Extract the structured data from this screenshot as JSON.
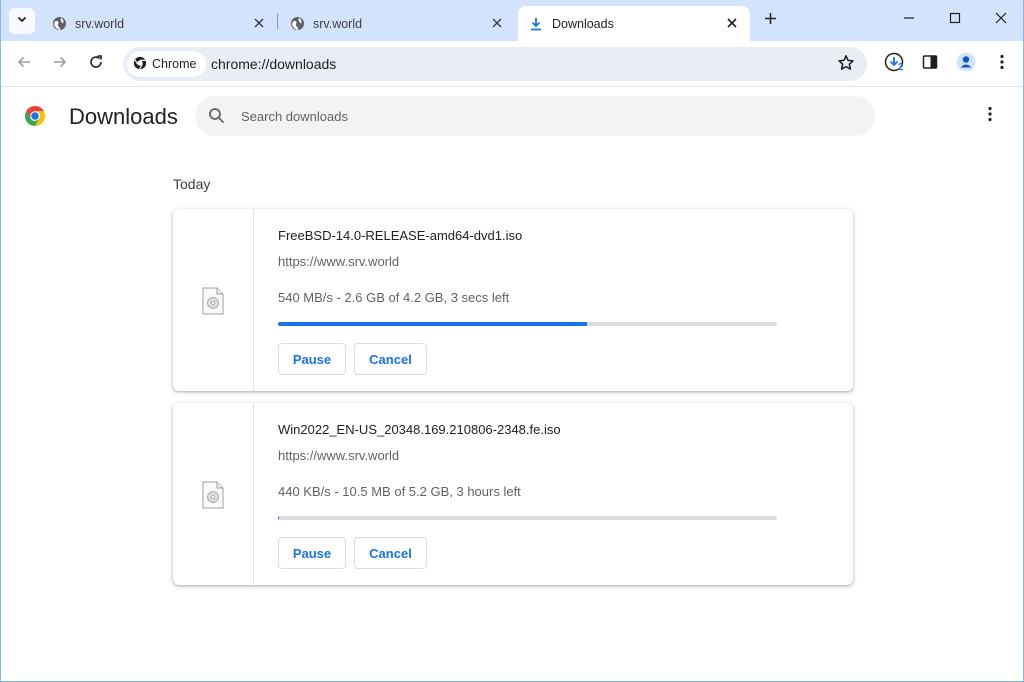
{
  "tabs": [
    {
      "title": "srv.world",
      "active": false
    },
    {
      "title": "srv.world",
      "active": false
    },
    {
      "title": "Downloads",
      "active": true
    }
  ],
  "toolbar": {
    "chip_label": "Chrome",
    "url": "chrome://downloads",
    "downloads_count": "2"
  },
  "header": {
    "title": "Downloads",
    "search_placeholder": "Search downloads"
  },
  "section_date": "Today",
  "downloads": [
    {
      "filename": "FreeBSD-14.0-RELEASE-amd64-dvd1.iso",
      "source": "https://www.srv.world",
      "status": "540 MB/s - 2.6 GB of 4.2 GB, 3 secs left",
      "progress_fraction": 0.62,
      "pause_label": "Pause",
      "cancel_label": "Cancel"
    },
    {
      "filename": "Win2022_EN-US_20348.169.210806-2348.fe.iso",
      "source": "https://www.srv.world",
      "status": "440 KB/s - 10.5 MB of 5.2 GB, 3 hours left",
      "progress_fraction": 0.002,
      "pause_label": "Pause",
      "cancel_label": "Cancel"
    }
  ],
  "colors": {
    "accent": "#1a73e8",
    "tabstrip": "#d3e3fd",
    "omnibox": "#e9eef6"
  },
  "icons": [
    "chevron-down-icon",
    "globe-icon",
    "download-icon",
    "close-icon",
    "plus-icon",
    "minimize-icon",
    "maximize-icon",
    "back-icon",
    "forward-icon",
    "reload-icon",
    "chrome-icon",
    "star-icon",
    "side-panel-icon",
    "profile-icon",
    "kebab-icon",
    "search-icon",
    "file-icon"
  ]
}
